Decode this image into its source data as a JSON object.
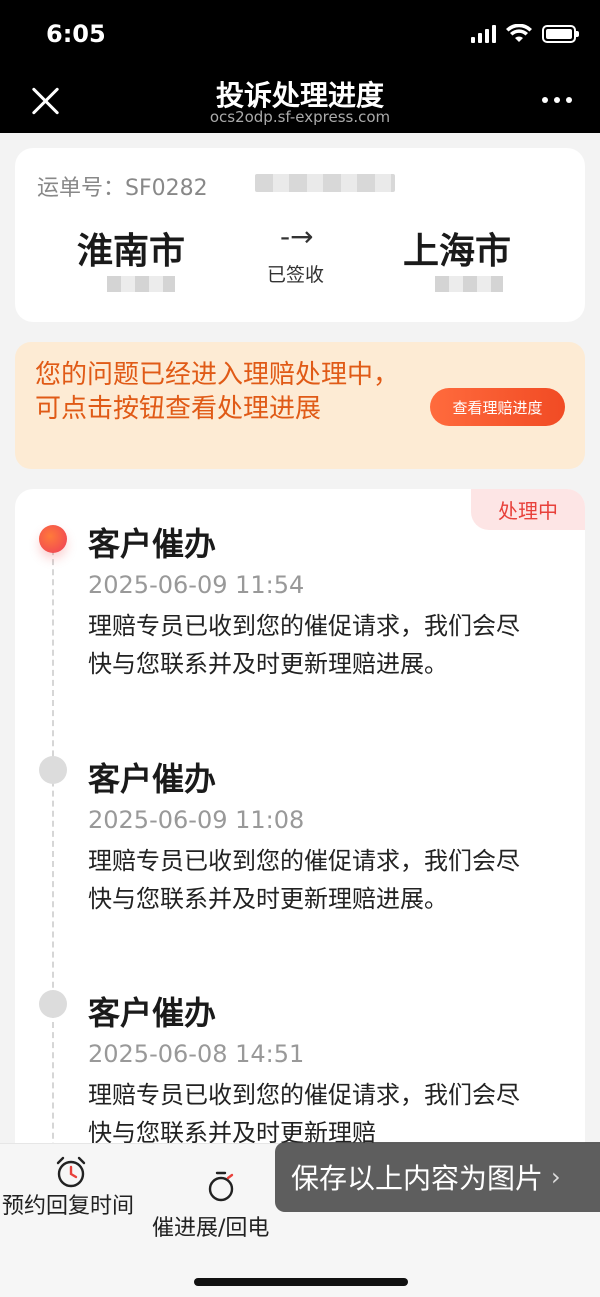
{
  "status_bar": {
    "time": "6:05"
  },
  "header": {
    "title": "投诉处理进度",
    "url": "ocs2odp.sf-express.com"
  },
  "waybill": {
    "label": "运单号：SF0282",
    "from_city": "淮南市",
    "to_city": "上海市",
    "arrow": "-→",
    "status": "已签收"
  },
  "notice": {
    "text": "您的问题已经进入理赔处理中，可点击按钮查看处理进展",
    "button_label": "查看理赔进度"
  },
  "timeline": {
    "status_tag": "处理中",
    "items": [
      {
        "title": "客户催办",
        "time": "2025-06-09 11:54",
        "desc": "理赔专员已收到您的催促请求，我们会尽快与您联系并及时更新理赔进展。"
      },
      {
        "title": "客户催办",
        "time": "2025-06-09 11:08",
        "desc": "理赔专员已收到您的催促请求，我们会尽快与您联系并及时更新理赔进展。"
      },
      {
        "title": "客户催办",
        "time": "2025-06-08 14:51",
        "desc": "理赔专员已收到您的催促请求，我们会尽快与您联系并及时更新理赔"
      }
    ]
  },
  "bottom": {
    "reply_label": "预约回复时间",
    "urge_label": "催进展/回电",
    "save_label": "保存以上内容为图片",
    "save_chevron": "›"
  },
  "colors": {
    "accent": "#f14b24",
    "notice_text": "#e05a16",
    "notice_bg": "#fdebd4",
    "status_tag": "#e8413b"
  }
}
